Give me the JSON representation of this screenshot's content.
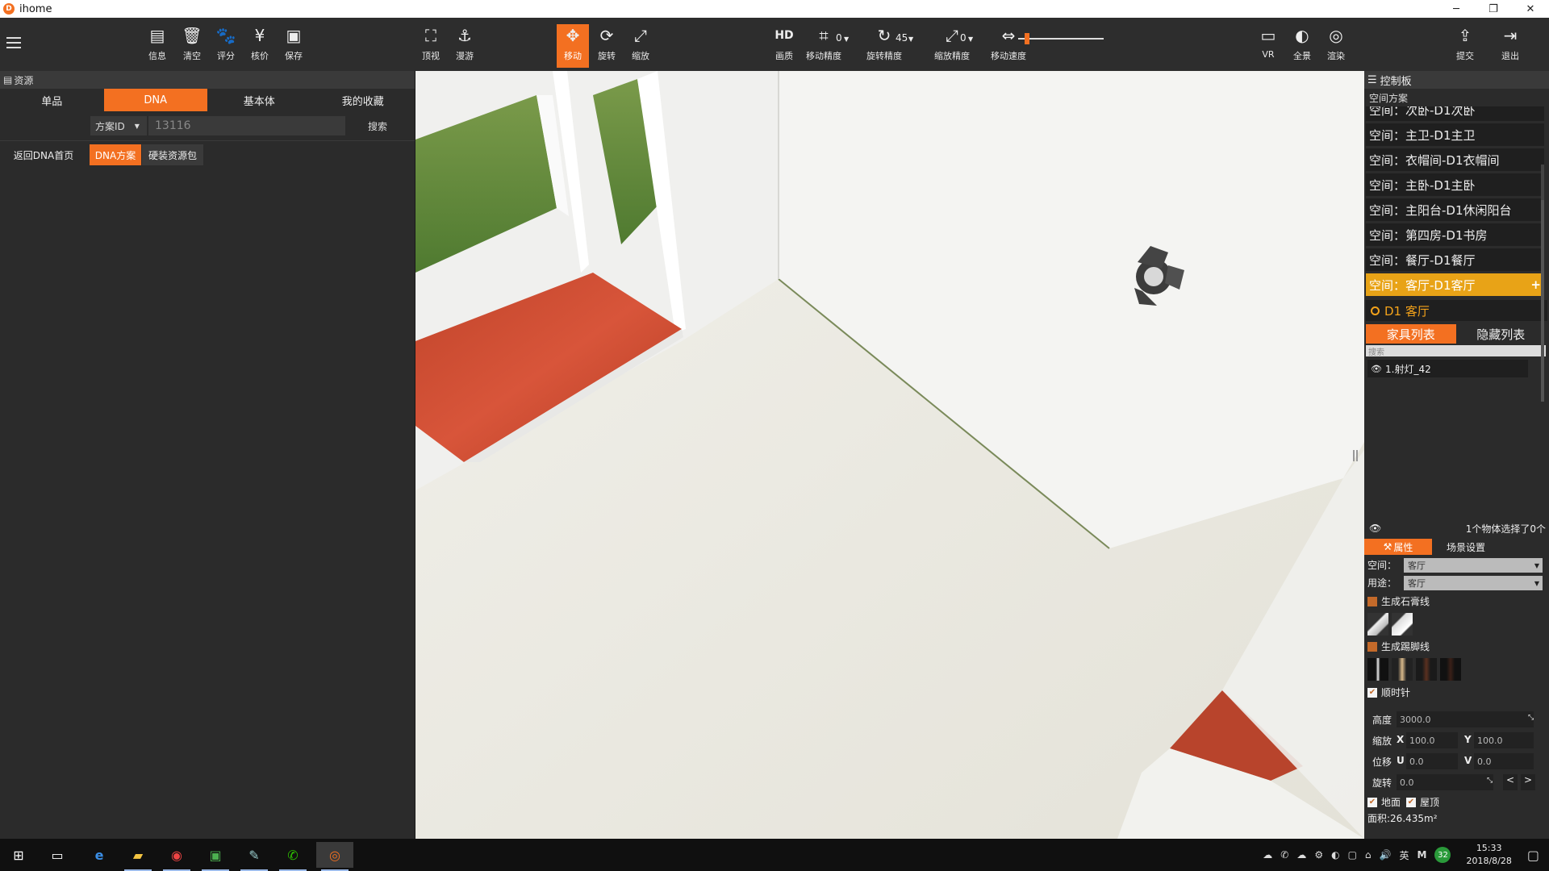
{
  "window": {
    "title": "ihome",
    "app_icon_letter": "D"
  },
  "toolbar": {
    "left_buttons": [
      {
        "label": "信息",
        "icon": "info-list-icon"
      },
      {
        "label": "清空",
        "icon": "trash-icon"
      },
      {
        "label": "评分",
        "icon": "paw-icon"
      },
      {
        "label": "核价",
        "icon": "yen-icon"
      },
      {
        "label": "保存",
        "icon": "save-icon"
      }
    ],
    "view_buttons": [
      {
        "label": "顶视",
        "icon": "top-view-icon"
      },
      {
        "label": "漫游",
        "icon": "roam-icon"
      }
    ],
    "transform_buttons": [
      {
        "label": "移动",
        "icon": "move-icon",
        "active": true
      },
      {
        "label": "旋转",
        "icon": "rotate-icon",
        "active": false
      },
      {
        "label": "缩放",
        "icon": "scale-icon",
        "active": false
      }
    ],
    "quality": {
      "label": "画质",
      "icon_text": "HD"
    },
    "move_precision": {
      "label": "移动精度",
      "value": "0"
    },
    "rotate_precision": {
      "label": "旋转精度",
      "value": "45"
    },
    "scale_precision": {
      "label": "缩放精度",
      "value": "0"
    },
    "move_speed": {
      "label": "移动速度",
      "level": 0.1
    },
    "right_buttons": [
      {
        "label": "VR",
        "icon": "vr-icon"
      },
      {
        "label": "全景",
        "icon": "panorama-icon"
      },
      {
        "label": "渲染",
        "icon": "render-icon"
      }
    ],
    "far_right_buttons": [
      {
        "label": "提交",
        "icon": "submit-icon"
      },
      {
        "label": "退出",
        "icon": "exit-icon"
      }
    ]
  },
  "left_panel": {
    "header": "资源",
    "tabs": [
      {
        "label": "单品",
        "active": false
      },
      {
        "label": "DNA",
        "active": true
      },
      {
        "label": "基本体",
        "active": false
      },
      {
        "label": "我的收藏",
        "active": false
      }
    ],
    "search": {
      "select_value": "方案ID",
      "input_value": "13116",
      "button": "搜索"
    },
    "sub_buttons": [
      {
        "label": "返回DNA首页",
        "active": false
      },
      {
        "label": "DNA方案",
        "active": true
      },
      {
        "label": "硬装资源包",
        "active": false
      }
    ]
  },
  "right_panel": {
    "header": "控制板",
    "section": "空间方案",
    "rooms": [
      {
        "label": "空间：次卧-D1次卧",
        "active": false
      },
      {
        "label": "空间：主卫-D1主卫",
        "active": false
      },
      {
        "label": "空间：衣帽间-D1衣帽间",
        "active": false
      },
      {
        "label": "空间：主卧-D1主卧",
        "active": false
      },
      {
        "label": "空间：主阳台-D1休闲阳台",
        "active": false
      },
      {
        "label": "空间：第四房-D1书房",
        "active": false
      },
      {
        "label": "空间：餐厅-D1餐厅",
        "active": false
      },
      {
        "label": "空间：客厅-D1客厅",
        "active": true
      }
    ],
    "room_title": "D1 客厅",
    "list_tabs": [
      {
        "label": "家具列表",
        "active": true
      },
      {
        "label": "隐藏列表",
        "active": false
      }
    ],
    "list_search_placeholder": "搜索",
    "list_items": [
      "1.射灯_42"
    ],
    "selection_info": "1个物体选择了0个",
    "prop_tabs": [
      {
        "label": "属性",
        "active": true
      },
      {
        "label": "场景设置",
        "active": false
      }
    ],
    "properties": {
      "space_label": "空间：",
      "space_value": "客厅",
      "usage_label": "用途：",
      "usage_value": "客厅",
      "gypsum_label": "生成石膏线",
      "skirting_label": "生成踢脚线",
      "clockwise_label": "顺时针",
      "height_label": "高度",
      "height_value": "3000.0",
      "scale_label": "缩放",
      "scale_x_label": "X",
      "scale_x_value": "100.0",
      "scale_y_label": "Y",
      "scale_y_value": "100.0",
      "offset_label": "位移",
      "offset_u_label": "U",
      "offset_u_value": "0.0",
      "offset_v_label": "V",
      "offset_v_value": "0.0",
      "rotate_label": "旋转",
      "rotate_value": "0.0",
      "prev": "<",
      "next": ">",
      "floor_label": "地面",
      "ceiling_label": "屋顶",
      "area_text": "面积:26.435m²"
    }
  },
  "taskbar": {
    "tray_lang": "英",
    "tray_badge": "32",
    "time": "15:33",
    "date": "2018/8/28"
  },
  "colors": {
    "accent": "#f37021",
    "active_room": "#e8a317",
    "panel": "#2b2b2b"
  }
}
